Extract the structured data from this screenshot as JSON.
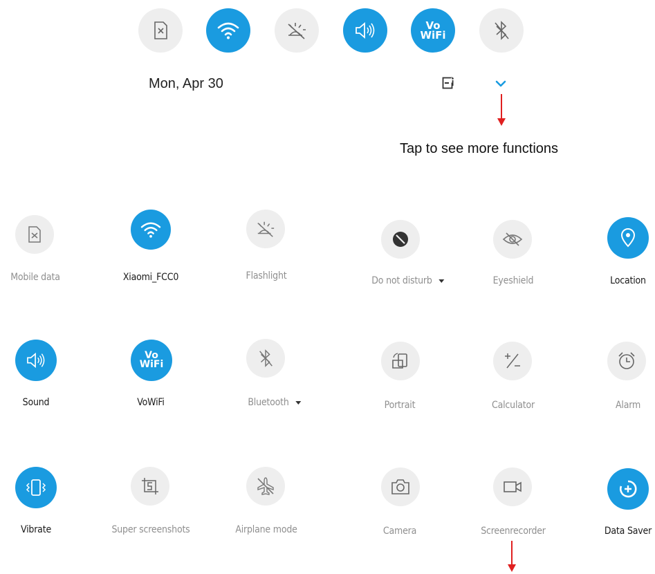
{
  "header": {
    "date": "Mon, Apr 30",
    "quick_icons": [
      "sim-icon",
      "wifi-icon",
      "flashlight-icon",
      "sound-icon",
      "vowifi-icon",
      "bluetooth-icon"
    ],
    "vowifi_text": "Vo\nWiFi",
    "edit_icon": "edit-icon",
    "expand_icon": "chevron-down-icon"
  },
  "annotation": {
    "text": "Tap to see more functions",
    "arrow_color": "#e02020"
  },
  "colors": {
    "active": "#1a9be0",
    "inactive": "#eeeeee",
    "label_active": "#1a1a1a",
    "label_inactive": "#8f8f8f"
  },
  "tiles": [
    {
      "label": "Mobile data",
      "icon": "sim-icon",
      "active": false
    },
    {
      "label": "Xiaomi_FCC0",
      "icon": "wifi-icon",
      "active": true
    },
    {
      "label": "Flashlight",
      "icon": "flashlight-icon",
      "active": false
    },
    {
      "label": "Do not disturb",
      "icon": "moon-icon",
      "active": false,
      "dropdown": true
    },
    {
      "label": "Eyeshield",
      "icon": "eye-off-icon",
      "active": false
    },
    {
      "label": "Location",
      "icon": "location-pin-icon",
      "active": true
    },
    {
      "label": "Sound",
      "icon": "sound-icon",
      "active": true
    },
    {
      "label": "VoWiFi",
      "icon": "vowifi-icon",
      "active": true
    },
    {
      "label": "Bluetooth",
      "icon": "bluetooth-icon",
      "active": false,
      "dropdown": true
    },
    {
      "label": "Portrait",
      "icon": "rotate-icon",
      "active": false
    },
    {
      "label": "Calculator",
      "icon": "calculator-icon",
      "active": false
    },
    {
      "label": "Alarm",
      "icon": "alarm-clock-icon",
      "active": false
    },
    {
      "label": "Vibrate",
      "icon": "vibrate-icon",
      "active": true
    },
    {
      "label": "Super screenshots",
      "icon": "screenshot-icon",
      "active": false
    },
    {
      "label": "Airplane mode",
      "icon": "airplane-icon",
      "active": false
    },
    {
      "label": "Camera",
      "icon": "camera-icon",
      "active": false
    },
    {
      "label": "Screenrecorder",
      "icon": "video-icon",
      "active": false
    },
    {
      "label": "Data Saver",
      "icon": "data-saver-icon",
      "active": true
    }
  ]
}
